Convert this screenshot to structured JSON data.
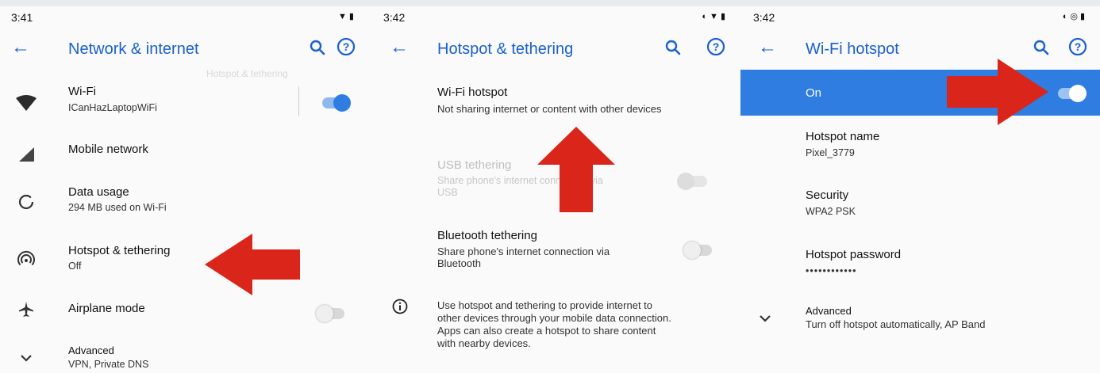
{
  "colors": {
    "accent": "#1a5fd1",
    "switch_on": "#2f7de0",
    "arrow": "#d9251a"
  },
  "screens": [
    {
      "status_time": "3:41",
      "title": "Network & internet",
      "items": [
        {
          "icon": "wifi-icon",
          "primary": "Wi-Fi",
          "secondary": "ICanHazLaptopWiFi",
          "toggle": "on"
        },
        {
          "icon": "mobile-network-icon",
          "primary": "Mobile network",
          "secondary": ""
        },
        {
          "icon": "data-usage-icon",
          "primary": "Data usage",
          "secondary": "294 MB used on Wi-Fi"
        },
        {
          "icon": "hotspot-icon",
          "primary": "Hotspot & tethering",
          "secondary": "Off"
        },
        {
          "icon": "airplane-icon",
          "primary": "Airplane mode",
          "secondary": "",
          "toggle": "off"
        },
        {
          "icon": "chevron-down-icon",
          "primary": "Advanced",
          "secondary": "VPN, Private DNS"
        }
      ]
    },
    {
      "status_time": "3:42",
      "title": "Hotspot & tethering",
      "items": [
        {
          "primary": "Wi-Fi hotspot",
          "secondary": "Not sharing internet or content with other devices"
        },
        {
          "primary": "USB tethering",
          "secondary_lines": [
            "Share phone's internet connection via",
            "USB"
          ],
          "disabled": true,
          "toggle": "off"
        },
        {
          "primary": "Bluetooth tethering",
          "secondary_lines": [
            "Share phone's internet connection via",
            "Bluetooth"
          ],
          "toggle": "off"
        }
      ],
      "info_icon": "info-icon",
      "info_lines": [
        "Use hotspot and tethering to provide internet to",
        "other devices through your mobile data connection.",
        "Apps can also create a hotspot to share content",
        "with nearby devices."
      ]
    },
    {
      "status_time": "3:42",
      "title": "Wi-Fi hotspot",
      "master_switch": {
        "label": "On",
        "state": "on"
      },
      "items": [
        {
          "primary": "Hotspot name",
          "secondary": "Pixel_3779"
        },
        {
          "primary": "Security",
          "secondary": "WPA2 PSK"
        },
        {
          "primary": "Hotspot password",
          "secondary": "••••••••••••"
        },
        {
          "icon": "chevron-down-icon",
          "primary": "Advanced",
          "secondary": "Turn off hotspot automatically, AP Band"
        }
      ]
    }
  ]
}
